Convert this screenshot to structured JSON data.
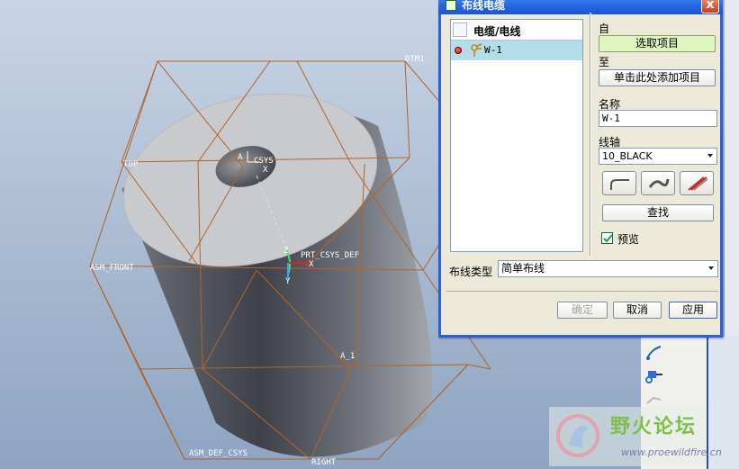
{
  "dialog": {
    "title": "布线电缆",
    "close_label": "x",
    "list": {
      "header": "电缆/电线",
      "rows": [
        {
          "label": "W-1"
        }
      ]
    },
    "from_label": "自",
    "select_item_button": "选取项目",
    "to_label": "至",
    "add_item_button": "单击此处添加项目",
    "name_label": "名称",
    "name_value": "W-1",
    "spool_label": "线轴",
    "spool_value": "10_BLACK",
    "find_button": "查找",
    "preview_label": "预览",
    "preview_checked": true,
    "route_type_label": "布线类型",
    "route_type_value": "简单布线",
    "ok_button": "确定",
    "cancel_button": "取消",
    "apply_button": "应用"
  },
  "viewport_labels": {
    "dtm": "DTM1",
    "top": "TOP",
    "csys": "CSYS",
    "csys_a": "A",
    "csys_x": "X",
    "prt_csys": "PRT_CSYS_DEF",
    "asm_front": "ASM_FRONT",
    "axis": "A_1",
    "asm_def_csys": "ASM_DEF_CSYS",
    "right": "RIGHT",
    "z": "Z",
    "x": "X",
    "y": "Y"
  },
  "watermark": {
    "title": "野火论坛",
    "url": "www.proewildfire.cn"
  },
  "colors": {
    "title_bar": "#2463e0",
    "datum_lines": "#b0652a",
    "highlight_button": "#dff5c0",
    "list_selection": "#b3dde8"
  }
}
